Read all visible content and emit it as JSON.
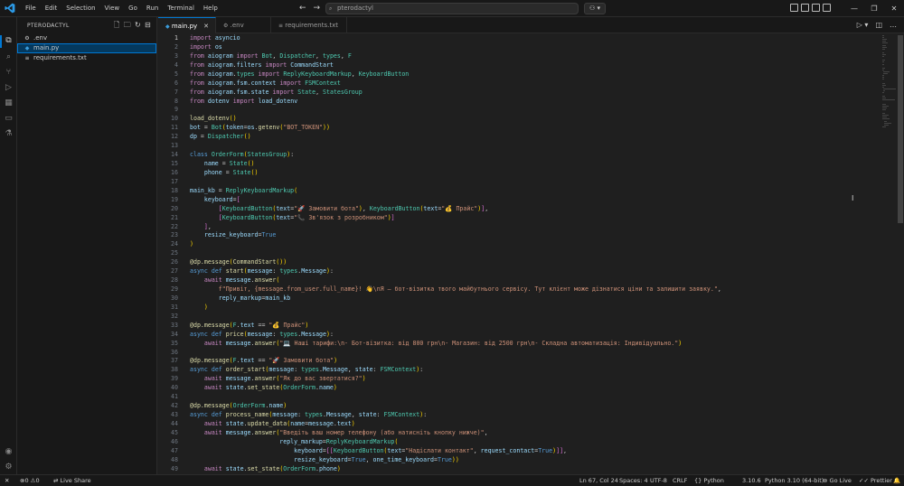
{
  "menu": [
    "File",
    "Edit",
    "Selection",
    "View",
    "Go",
    "Run",
    "Terminal",
    "Help"
  ],
  "command_center": {
    "text": "pterodactyl"
  },
  "sidebar": {
    "title": "PTERODACTYL",
    "files": [
      {
        "name": ".env",
        "icon": "gear-icon"
      },
      {
        "name": "main.py",
        "icon": "python-icon",
        "selected": true
      },
      {
        "name": "requirements.txt",
        "icon": "text-file-icon"
      }
    ]
  },
  "tabs": [
    {
      "label": "main.py",
      "active": true,
      "close": "✕"
    },
    {
      "label": ".env"
    },
    {
      "label": "requirements.txt"
    }
  ],
  "code_lines": [
    "import asyncio",
    "import os",
    "from aiogram import Bot, Dispatcher, types, F",
    "from aiogram.filters import CommandStart",
    "from aiogram.types import ReplyKeyboardMarkup, KeyboardButton",
    "from aiogram.fsm.context import FSMContext",
    "from aiogram.fsm.state import State, StatesGroup",
    "from dotenv import load_dotenv",
    "",
    "load_dotenv()",
    "bot = Bot(token=os.getenv(\"BOT_TOKEN\"))",
    "dp = Dispatcher()",
    "",
    "class OrderForm(StatesGroup):",
    "    name = State()",
    "    phone = State()",
    "",
    "main_kb = ReplyKeyboardMarkup(",
    "    keyboard=[",
    "        [KeyboardButton(text=\"🚀 Замовити бота\"), KeyboardButton(text=\"💰 Прайс\")],",
    "        [KeyboardButton(text=\"📞 Зв'язок з розробником\")]",
    "    ],",
    "    resize_keyboard=True",
    ")",
    "",
    "@dp.message(CommandStart())",
    "async def start(message: types.Message):",
    "    await message.answer(",
    "        f\"Привіт, {message.from_user.full_name}! 👋\\nЯ — бот-візитка твого майбутнього сервісу. Тут клієнт може дізнатися ціни та залишити заявку.\",",
    "        reply_markup=main_kb",
    "    )",
    "",
    "@dp.message(F.text == \"💰 Прайс\")",
    "async def price(message: types.Message):",
    "    await message.answer(\"💻 Наші тарифи:\\n- Бот-візитка: від 800 грн\\n- Магазин: від 2500 грн\\n- Складна автоматизація: Індивідуально.\")",
    "",
    "@dp.message(F.text == \"🚀 Замовити бота\")",
    "async def order_start(message: types.Message, state: FSMContext):",
    "    await message.answer(\"Як до вас звертатися?\")",
    "    await state.set_state(OrderForm.name)",
    "",
    "@dp.message(OrderForm.name)",
    "async def process_name(message: types.Message, state: FSMContext):",
    "    await state.update_data(name=message.text)",
    "    await message.answer(\"Введіть ваш номер телефону (або натисніть кнопку нижче)\",",
    "                         reply_markup=ReplyKeyboardMarkup(",
    "                             keyboard=[[KeyboardButton(text=\"Надіслати контакт\", request_contact=True)]],",
    "                             resize_keyboard=True, one_time_keyboard=True))",
    "    await state.set_state(OrderForm.phone)",
    ""
  ],
  "status": {
    "errors": "0",
    "warnings": "0",
    "live_share": "Live Share",
    "position": "Ln 67, Col 24",
    "spaces": "Spaces: 4",
    "encoding": "UTF-8",
    "eol": "CRLF",
    "language": "Python",
    "version": "3.10.6",
    "interpreter": "Python 3.10 (64-bit)",
    "go_live": "Go Live",
    "prettier": "Prettier"
  },
  "colors": {
    "accent": "#0078d4",
    "editor_bg": "#1f1f1f",
    "chrome_bg": "#181818"
  }
}
